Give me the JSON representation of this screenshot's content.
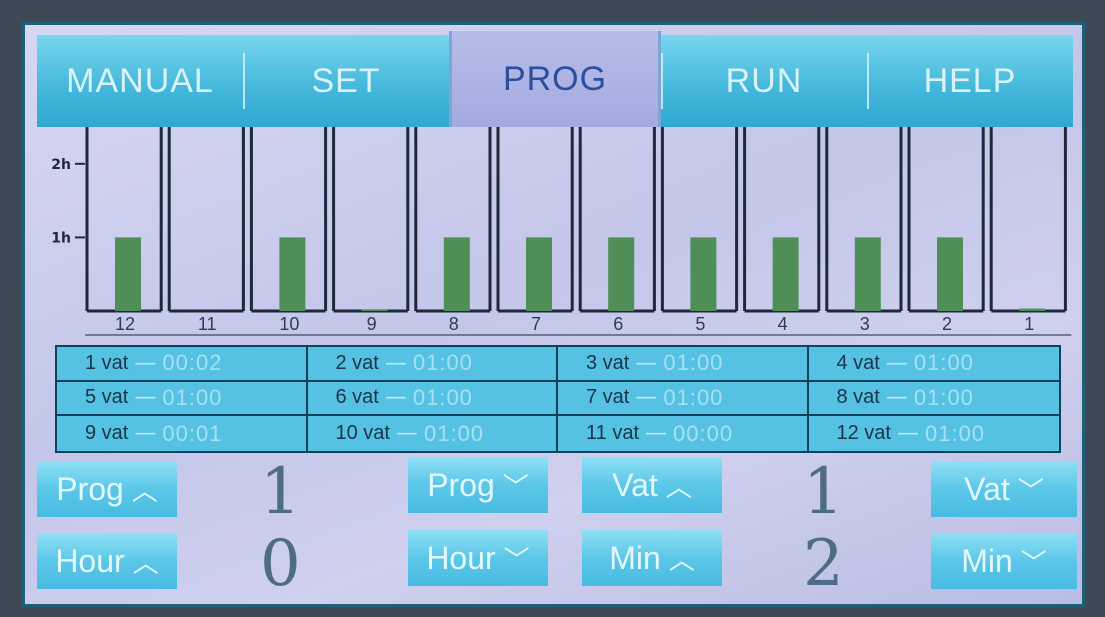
{
  "tabs": [
    {
      "label": "MANUAL",
      "active": false
    },
    {
      "label": "SET",
      "active": false
    },
    {
      "label": "PROG",
      "active": true
    },
    {
      "label": "RUN",
      "active": false
    },
    {
      "label": "HELP",
      "active": false
    }
  ],
  "chart_data": {
    "type": "bar",
    "categories": [
      "12",
      "11",
      "10",
      "9",
      "8",
      "7",
      "6",
      "5",
      "4",
      "3",
      "2",
      "1"
    ],
    "values": [
      1.0,
      0.0,
      1.0,
      0.017,
      1.0,
      1.0,
      1.0,
      1.0,
      1.0,
      1.0,
      1.0,
      0.033
    ],
    "ylim": [
      0,
      2.5
    ],
    "yticks": [
      {
        "value": 2,
        "label": "2h"
      },
      {
        "value": 1,
        "label": "1h"
      }
    ],
    "bar_color": "#4f8f57"
  },
  "vats": [
    {
      "label": "1 vat",
      "time": "00:02"
    },
    {
      "label": "2 vat",
      "time": "01:00"
    },
    {
      "label": "3 vat",
      "time": "01:00"
    },
    {
      "label": "4 vat",
      "time": "01:00"
    },
    {
      "label": "5 vat",
      "time": "01:00"
    },
    {
      "label": "6 vat",
      "time": "01:00"
    },
    {
      "label": "7 vat",
      "time": "01:00"
    },
    {
      "label": "8 vat",
      "time": "01:00"
    },
    {
      "label": "9 vat",
      "time": "00:01"
    },
    {
      "label": "10 vat",
      "time": "01:00"
    },
    {
      "label": "11 vat",
      "time": "00:00"
    },
    {
      "label": "12 vat",
      "time": "01:00"
    }
  ],
  "dash": "—",
  "controls": {
    "prog_up": "Prog",
    "prog_down": "Prog",
    "hour_up": "Hour",
    "hour_down": "Hour",
    "vat_up": "Vat",
    "vat_down": "Vat",
    "min_up": "Min",
    "min_down": "Min",
    "prog_value": "1",
    "hour_value": "0",
    "vat_value": "1",
    "min_value": "2"
  },
  "icons": {
    "up": "chevron-up-icon",
    "down": "chevron-down-icon"
  }
}
